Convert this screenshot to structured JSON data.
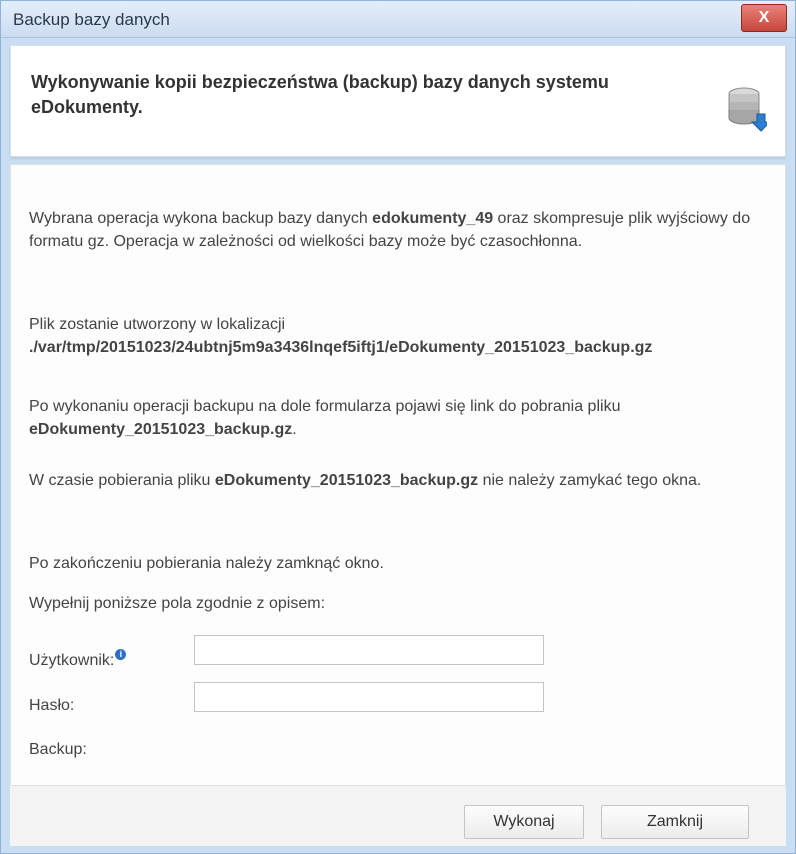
{
  "window": {
    "title": "Backup bazy danych",
    "close_label": "X"
  },
  "header": {
    "title": "Wykonywanie kopii bezpieczeństwa (backup) bazy danych systemu eDokumenty.",
    "icon": "database-icon"
  },
  "body": {
    "p1_prefix": "Wybrana operacja wykona backup bazy danych ",
    "p1_db": "edokumenty_49",
    "p1_suffix": " oraz skompresuje plik wyjściowy do formatu gz. Operacja w zależności od wielkości bazy może być czasochłonna.",
    "p2_prefix": "Plik zostanie utworzony w lokalizacji",
    "p2_path": "./var/tmp/20151023/24ubtnj5m9a3436lnqef5iftj1/eDokumenty_20151023_backup.gz",
    "p3_prefix": "Po wykonaniu operacji backupu na dole formularza pojawi się link do pobrania pliku ",
    "p3_file": "eDokumenty_20151023_backup.gz",
    "p3_suffix": ".",
    "p4_prefix": "W czasie pobierania pliku ",
    "p4_file": "eDokumenty_20151023_backup.gz",
    "p4_suffix": " nie należy zamykać tego okna.",
    "p5": "Po zakończeniu pobierania należy zamknąć okno.",
    "p6": "Wypełnij poniższe pola zgodnie z opisem:"
  },
  "form": {
    "user_label": "Użytkownik:",
    "user_info": "i",
    "user_value": "",
    "password_label": "Hasło:",
    "password_value": "",
    "backup_label": "Backup:"
  },
  "footer": {
    "run_label": "Wykonaj",
    "close_label": "Zamknij"
  }
}
